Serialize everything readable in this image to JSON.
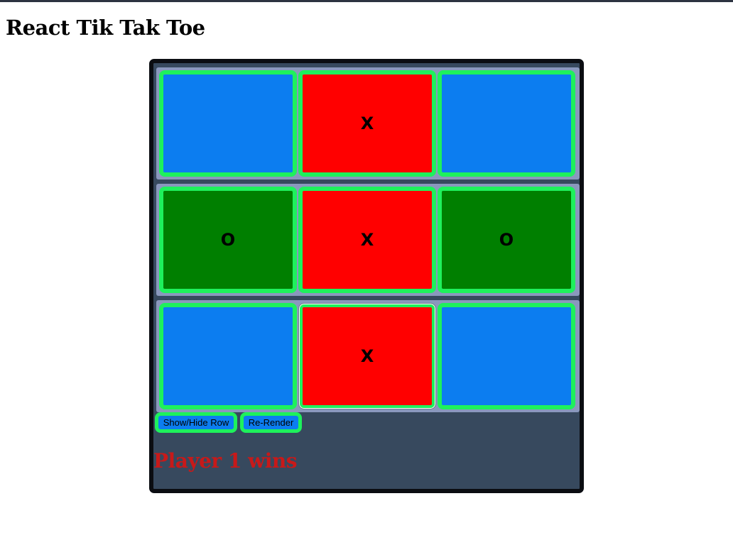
{
  "page": {
    "title": "React Tik Tak Toe"
  },
  "board": {
    "rows": [
      {
        "cells": [
          {
            "value": "",
            "color": "#0c7df0"
          },
          {
            "value": "X",
            "color": "#ff0000"
          },
          {
            "value": "",
            "color": "#0c7df0"
          }
        ]
      },
      {
        "cells": [
          {
            "value": "O",
            "color": "#007f00"
          },
          {
            "value": "X",
            "color": "#ff0000"
          },
          {
            "value": "O",
            "color": "#007f00"
          }
        ]
      },
      {
        "cells": [
          {
            "value": "",
            "color": "#0c7df0"
          },
          {
            "value": "X",
            "color": "#ff0000"
          },
          {
            "value": "",
            "color": "#0c7df0"
          }
        ]
      }
    ],
    "cell_border_color": "#1ef15c",
    "row_background_color": "#8a98bd",
    "container_background_color": "#37495e"
  },
  "controls": {
    "show_hide_label": "Show/Hide Row",
    "rerender_label": "Re-Render"
  },
  "status": {
    "message": "Player 1 wins",
    "color": "#c81919"
  }
}
